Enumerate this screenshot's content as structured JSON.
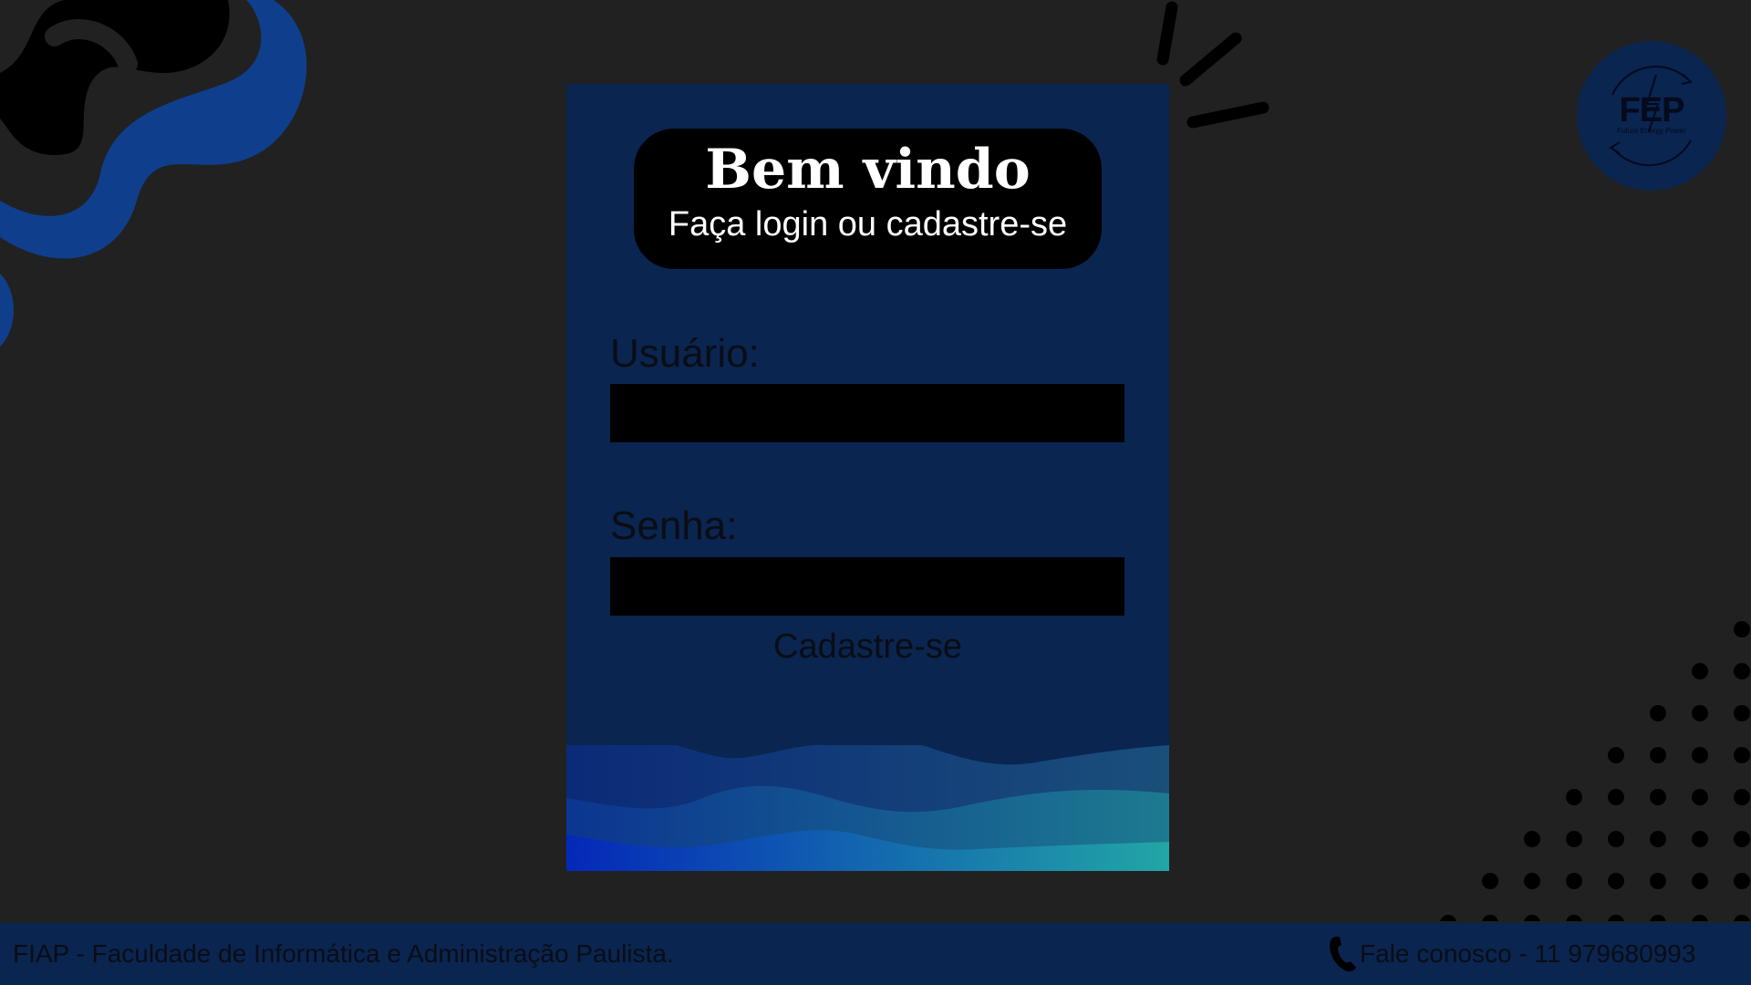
{
  "welcome": {
    "title": "Bem vindo",
    "subtitle": "Faça login ou cadastre-se"
  },
  "form": {
    "username_label": "Usuário:",
    "username_value": "",
    "password_label": "Senha:",
    "password_value": "",
    "signup_link": "Cadastre-se"
  },
  "logo": {
    "name": "FEP",
    "tagline": "Future Energy Power",
    "icon": "fep-logo-icon"
  },
  "footer": {
    "institution": "FIAP - Faculdade de Informática e Administração Paulista.",
    "contact": "Fale conosco - 11 979680993",
    "contact_icon": "phone-icon"
  },
  "colors": {
    "background": "#212121",
    "card": "#0a2550",
    "accent_blue": "#0f3f8c",
    "footer": "#0a2550"
  }
}
